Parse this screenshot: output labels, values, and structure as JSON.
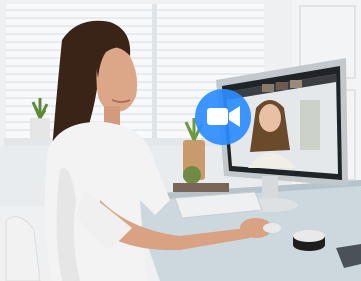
{
  "scene": {
    "icon": "zoom-video-camera-icon",
    "colors": {
      "zoom_blue": "#2D8CFF",
      "wall": "#f2f4f6",
      "window_light": "#eef3f7",
      "desk_glass": "#c9d6dd",
      "monitor_frame": "#c7ccd1",
      "screen_bg": "#e9ecef",
      "shirt": "#f4f4f4",
      "hair": "#3a2418",
      "skin": "#d9a283"
    }
  }
}
